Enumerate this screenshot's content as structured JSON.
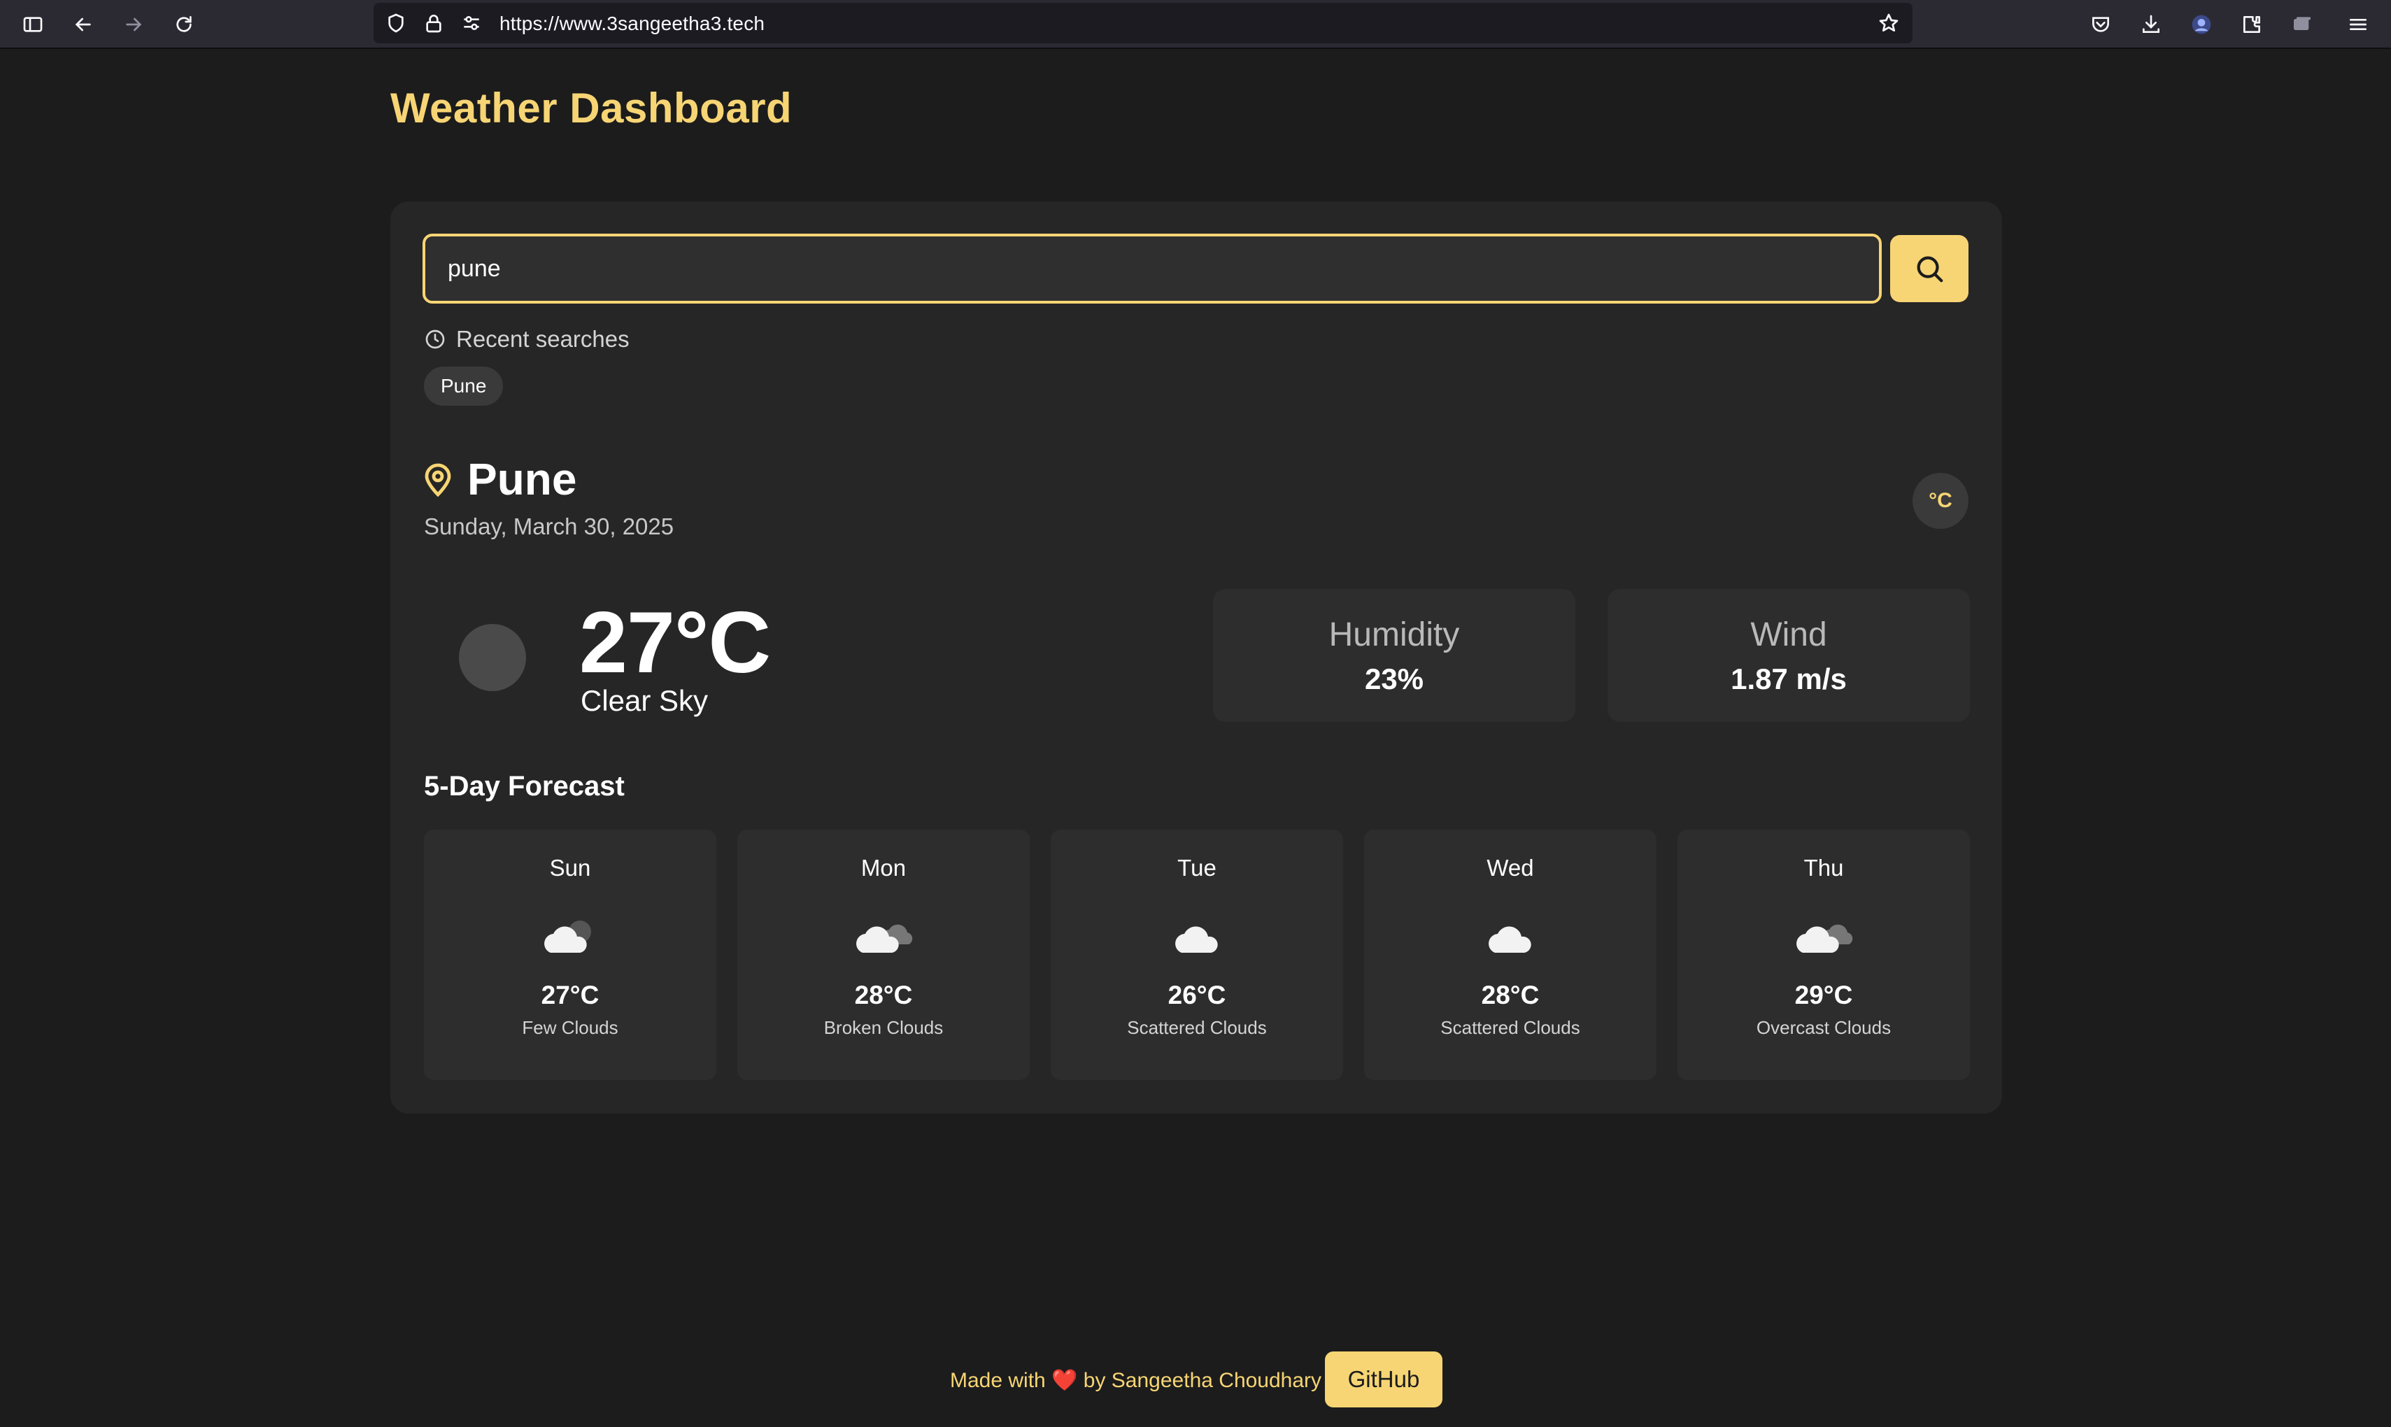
{
  "browser": {
    "url": "https://www.3sangeetha3.tech",
    "icons": [
      "sidebar-icon",
      "back-icon",
      "forward-icon",
      "reload-icon",
      "shield-icon",
      "lock-icon",
      "permissions-icon",
      "bookmark-star-icon",
      "pocket-icon",
      "download-icon",
      "profile-icon",
      "extensions-icon",
      "tab-view-icon",
      "menu-icon"
    ]
  },
  "header": {
    "title": "Weather Dashboard"
  },
  "search": {
    "value": "pune",
    "button_icon": "search-icon"
  },
  "recent": {
    "label": "Recent searches",
    "items": [
      "Pune"
    ]
  },
  "location": {
    "city": "Pune",
    "date": "Sunday, March 30, 2025",
    "unit_toggle": "°C"
  },
  "current": {
    "temperature": "27°C",
    "description": "Clear Sky",
    "humidity_label": "Humidity",
    "humidity_value": "23%",
    "wind_label": "Wind",
    "wind_value": "1.87 m/s"
  },
  "forecast": {
    "title": "5-Day Forecast",
    "days": [
      {
        "day": "Sun",
        "temp": "27°C",
        "desc": "Few Clouds",
        "icon": "few-clouds-icon"
      },
      {
        "day": "Mon",
        "temp": "28°C",
        "desc": "Broken Clouds",
        "icon": "broken-clouds-icon"
      },
      {
        "day": "Tue",
        "temp": "26°C",
        "desc": "Scattered Clouds",
        "icon": "scattered-clouds-icon"
      },
      {
        "day": "Wed",
        "temp": "28°C",
        "desc": "Scattered Clouds",
        "icon": "scattered-clouds-icon"
      },
      {
        "day": "Thu",
        "temp": "29°C",
        "desc": "Overcast Clouds",
        "icon": "overcast-clouds-icon"
      }
    ]
  },
  "footer": {
    "made_with": "Made with",
    "heart": "❤️",
    "by": "by Sangeetha Choudhary",
    "github_label": "GitHub"
  },
  "colors": {
    "accent": "#f7d574",
    "background": "#1c1c1c",
    "card": "#262626",
    "tile": "#2d2d2d"
  }
}
